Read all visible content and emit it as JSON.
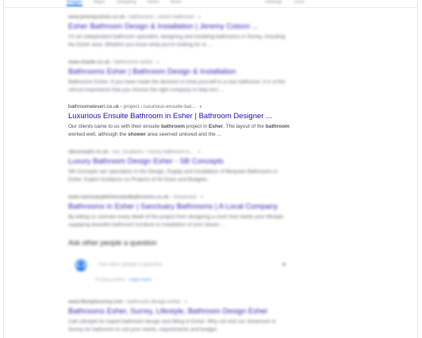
{
  "nav": {
    "items": [
      "Images",
      "Maps",
      "Shopping",
      "News",
      "More"
    ],
    "tools": [
      "Settings",
      "Tools"
    ]
  },
  "results": [
    {
      "cite_domain": "www.jeremycolson.co.uk",
      "cite_path": "› bathrooms › esher-bathroom",
      "title": "Esher Bathroom Design & Installation | Jeremy Colson ...",
      "snippet": "I'm an independent bathroom specialist, designing and installing bathrooms in Surrey, including the Esher area. Whether you know what you're looking for or ..."
    },
    {
      "cite_domain": "www.charlie.co.uk",
      "cite_path": "› bathrooms-esher",
      "title": "Bathrooms Esher | Bathroom Design & Installation",
      "snippet": "Bathrooms Esher. If you have made the decision to treat yourself to a new bathroom, it is of the utmost importance that you choose the right company to help turn ..."
    },
    {
      "cite_domain": "bathroomeleven.co.uk",
      "cite_path": "› project › luxurious-ensuite-bat...",
      "title": "Luxurious Ensuite Bathroom in Esher | Bathroom Designer ...",
      "snippet_parts": [
        {
          "t": "Our clients came to us with their ensuite ",
          "b": false
        },
        {
          "t": "bathroom",
          "b": true
        },
        {
          "t": " project in ",
          "b": false
        },
        {
          "t": "Esher",
          "b": true
        },
        {
          "t": ". The layout of the ",
          "b": false
        },
        {
          "t": "bathroom",
          "b": true
        },
        {
          "t": " worked well, although the ",
          "b": false
        },
        {
          "t": "shower",
          "b": true
        },
        {
          "t": " area seemed unloved and the ...",
          "b": false
        }
      ]
    },
    {
      "cite_domain": "sbconcepts.co.uk",
      "cite_path": "› our_locations › luxury-bathroom-e...",
      "title": "Luxury Bathroom Design Esher - SB Concepts",
      "snippet": "SB Concepts are specialists in the Design, Supply and Installation of Bespoke Bathrooms in Esher. Expert Guidance on Projects of All Sizes and Budgets."
    },
    {
      "cite_domain": "www.sanctuarykitchensandbathrooms.co.uk",
      "cite_path": "› showroom",
      "title": "Bathrooms in Esher | Sanctuary Bathrooms | A Local Company",
      "snippet": "By letting us oversee every detail of the project from designing a room that meets your lifestyle supplying beautiful bathroom furniture to installation of your dream ..."
    },
    {
      "cite_domain": "www.lifestylesurrey.com",
      "cite_path": "› bathroom-design-esher",
      "title": "Bathrooms Esher, Surrey, Lifestyle, Bathroom Design Esher",
      "snippet": "Call Lifestyle for expert bathroom design and fitting in Esher. Why not visit our showroom in Surrey for bathroom to suit your needs, requirements and budget."
    }
  ],
  "paa": {
    "heading": "Ask other people a question",
    "placeholder": "Ask other people a question",
    "send": "▶",
    "footer_text": "Posting publicly",
    "footer_link": "Learn more"
  }
}
